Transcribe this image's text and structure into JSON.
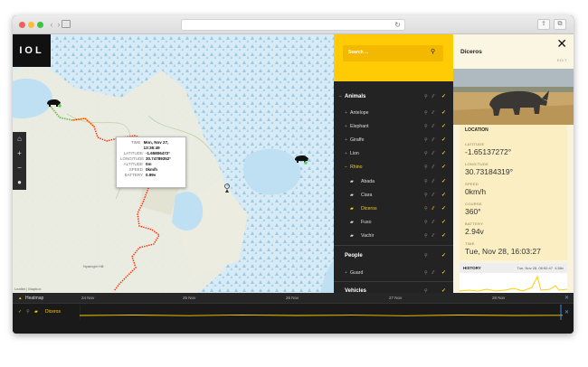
{
  "browser": {
    "nav_back": "‹",
    "nav_forward": "›",
    "reload_icon": "↻",
    "share_icon": "⇪",
    "tabs_icon": "⧉"
  },
  "brand": {
    "logo_text": "IOL"
  },
  "map": {
    "tools": [
      "⌂",
      "+",
      "−",
      "●"
    ],
    "attribution": "Leaflet | Mapbox",
    "peak_label": "Nyamghi Hill",
    "tooltip": {
      "rows": [
        {
          "k": "Time",
          "v": "Mon, Nov 27, 13:36:49"
        },
        {
          "k": "Latitude",
          "v": "-1.65806472°"
        },
        {
          "k": "Longitude",
          "v": "30.74789352°"
        },
        {
          "k": "Altitude",
          "v": "0m"
        },
        {
          "k": "Speed",
          "v": "0km/h"
        },
        {
          "k": "Battery",
          "v": "0.99v"
        }
      ]
    }
  },
  "search": {
    "placeholder": "Search ...",
    "icon": "search-icon"
  },
  "list": {
    "groups": [
      {
        "label": "Animals",
        "expanded": true
      },
      {
        "label": "People",
        "expanded": false
      },
      {
        "label": "Vehicles",
        "expanded": false
      }
    ],
    "species": [
      "Antelope",
      "Elephant",
      "Giraffe",
      "Lion",
      "Rhino"
    ],
    "rhinos": [
      "Abada",
      "Ciara",
      "Diceros",
      "Fuso",
      "Vachir"
    ],
    "people": [
      "Guard"
    ],
    "selected": "Diceros",
    "accent": "#ffcb05"
  },
  "detail": {
    "title": "Diceros",
    "edit_label": "EDIT",
    "close_icon": "✕",
    "location_title": "LOCATION",
    "fields": [
      {
        "label": "Latitude",
        "value": "-1.65137272°"
      },
      {
        "label": "Longitude",
        "value": "30.73184319°"
      },
      {
        "label": "Speed",
        "value": "0km/h"
      },
      {
        "label": "Course",
        "value": "360°"
      },
      {
        "label": "Battery",
        "value": "2.94v"
      },
      {
        "label": "Time",
        "value": "Tue, Nov 28, 16:03:27"
      }
    ],
    "history": {
      "title": "HISTORY",
      "timestamp": "Tue, Nov 28, 06:52:47",
      "battery": "4.58v"
    }
  },
  "timeline": {
    "heatmap_label": "Heatmap",
    "track_label": "Diceros",
    "dates": [
      "24 Nov",
      "25 Nov",
      "26 Nov",
      "27 Nov",
      "28 Nov"
    ],
    "close_icon": "✕"
  }
}
